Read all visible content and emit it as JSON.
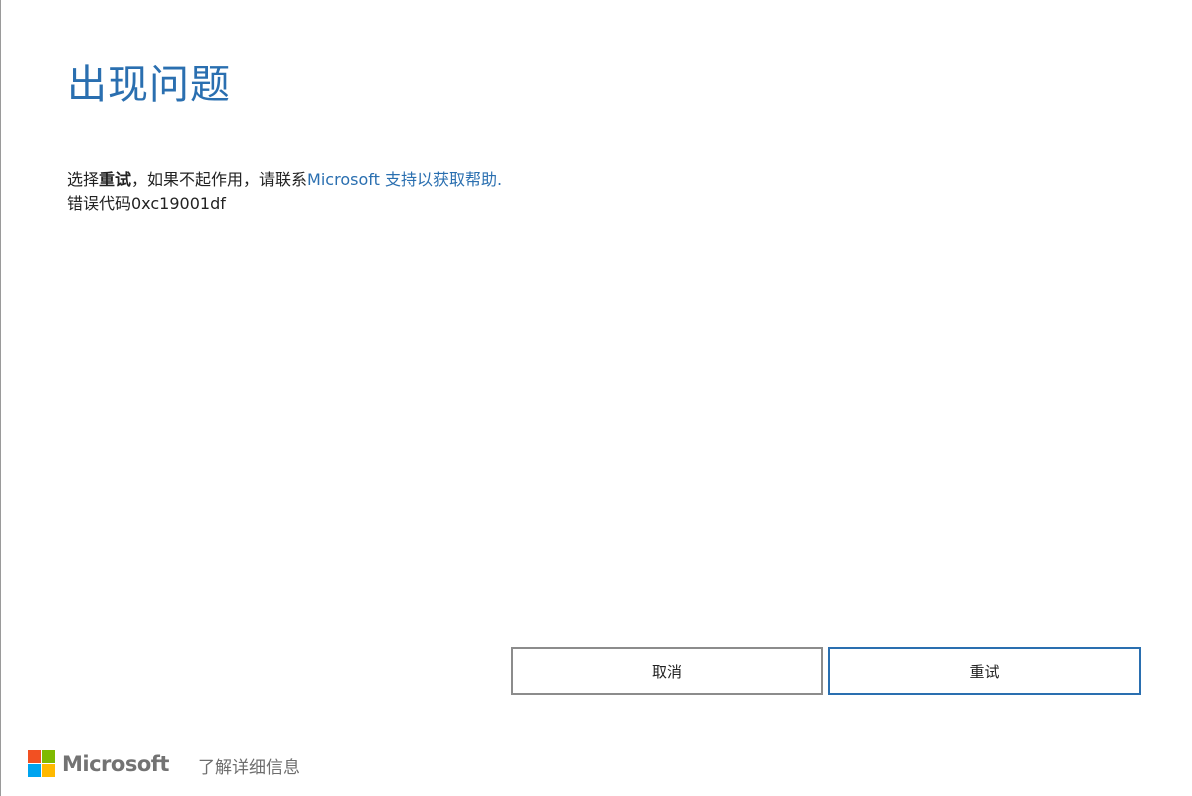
{
  "dialog": {
    "title": "出现问题",
    "message": {
      "prefix": "选择",
      "bold_action": "重试",
      "middle": "，如果不起作用，请联系",
      "link_text": "Microsoft 支持以获取帮助."
    },
    "error_code": "错误代码0xc19001df"
  },
  "buttons": {
    "cancel_label": "取消",
    "retry_label": "重试"
  },
  "footer": {
    "brand": "Microsoft",
    "learn_more": "了解详细信息"
  },
  "colors": {
    "accent": "#2a6fb0",
    "ms_red": "#f25022",
    "ms_green": "#7fba00",
    "ms_blue": "#00a4ef",
    "ms_yellow": "#ffb900"
  }
}
